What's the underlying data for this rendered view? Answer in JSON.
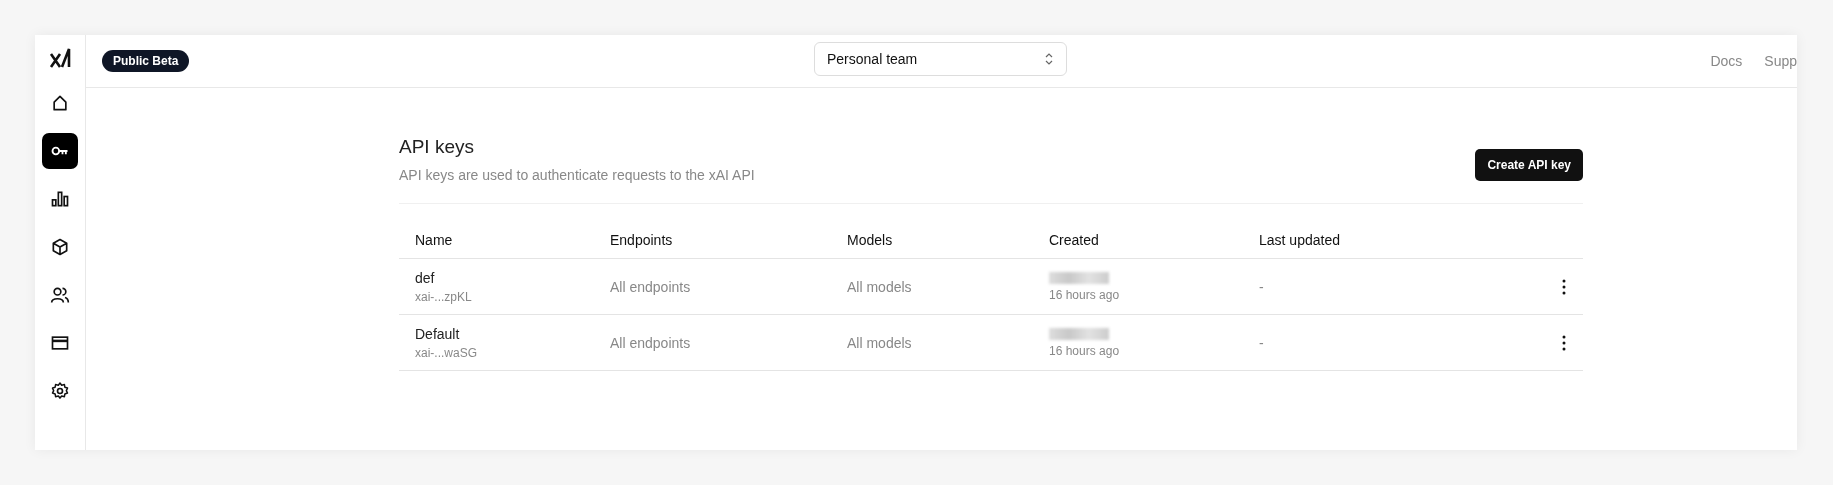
{
  "sidebar": {
    "items": [
      {
        "selected": false
      },
      {
        "selected": true
      },
      {
        "selected": false
      },
      {
        "selected": false
      },
      {
        "selected": false
      },
      {
        "selected": false
      },
      {
        "selected": false
      }
    ]
  },
  "header": {
    "badge": "Public Beta",
    "team_select": {
      "value": "Personal team"
    },
    "links": [
      "Docs",
      "Supp"
    ]
  },
  "page": {
    "title": "API keys",
    "subtitle": "API keys are used to authenticate requests to the xAI API",
    "create_button": "Create API key"
  },
  "table": {
    "columns": [
      "Name",
      "Endpoints",
      "Models",
      "Created",
      "Last updated"
    ],
    "rows": [
      {
        "name": "def",
        "key": "xai-...zpKL",
        "endpoints": "All endpoints",
        "models": "All models",
        "created_ago": "16 hours ago",
        "last_updated": "-"
      },
      {
        "name": "Default",
        "key": "xai-...waSG",
        "endpoints": "All endpoints",
        "models": "All models",
        "created_ago": "16 hours ago",
        "last_updated": "-"
      }
    ]
  }
}
